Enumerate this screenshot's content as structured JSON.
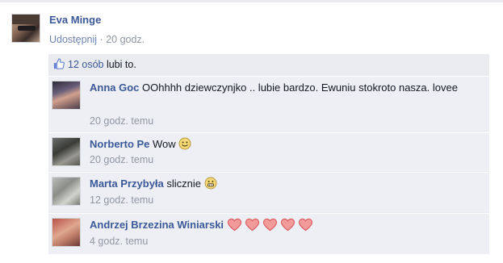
{
  "post": {
    "author": "Eva Minge",
    "share_label": "Udostępnij",
    "separator": " · ",
    "time": "20 godz."
  },
  "likes": {
    "count_text": "12 osób",
    "suffix": " lubi to."
  },
  "comments": [
    {
      "author": "Anna Goc",
      "text": " OOhhhh dziewczynjko .. lubie bardzo. Ewuniu stokroto nasza. lovee",
      "time": "20 godz. temu"
    },
    {
      "author": "Norberto Pe",
      "text": " Wow ",
      "time": "20 godz. temu",
      "emoji": "smile-emoji"
    },
    {
      "author": "Marta Przybyła",
      "text": " slicznie ",
      "time": "12 godz. temu",
      "emoji": "grin-emoji"
    },
    {
      "author": "Andrzej Brzezina Winiarski",
      "text": " ",
      "time": "4 godz. temu",
      "emoji": "heart-emoji x5"
    }
  ],
  "colors": {
    "link": "#3b5998",
    "meta": "#9197a3",
    "panel": "#e9ebee",
    "comment_bg": "#edeff4",
    "heart": "#f0777a"
  }
}
